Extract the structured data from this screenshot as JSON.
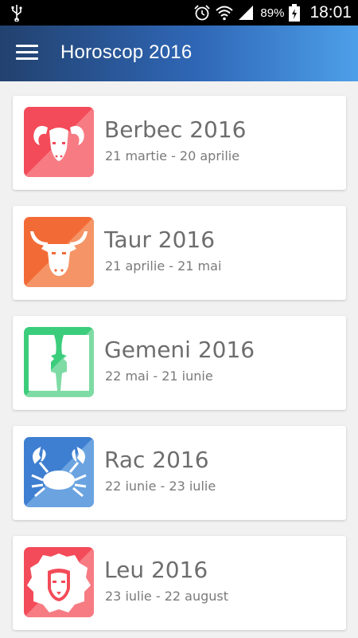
{
  "status_bar": {
    "battery": "89%",
    "time": "18:01"
  },
  "app_bar": {
    "title": "Horoscop 2016"
  },
  "signs": [
    {
      "title": "Berbec 2016",
      "dates": "21 martie - 20 aprilie",
      "icon": "aries-ram-icon",
      "color": "#f25560"
    },
    {
      "title": "Taur 2016",
      "dates": "21 aprilie - 21 mai",
      "icon": "taurus-bull-icon",
      "color": "#f07a43"
    },
    {
      "title": "Gemeni 2016",
      "dates": "22 mai - 21 iunie",
      "icon": "gemini-twins-icon",
      "color": "#3fcf7e"
    },
    {
      "title": "Rac 2016",
      "dates": "22 iunie - 23 iulie",
      "icon": "cancer-crab-icon",
      "color": "#4a86cf"
    },
    {
      "title": "Leu 2016",
      "dates": "23 iulie - 22 august",
      "icon": "leo-lion-icon",
      "color": "#f25560"
    }
  ]
}
